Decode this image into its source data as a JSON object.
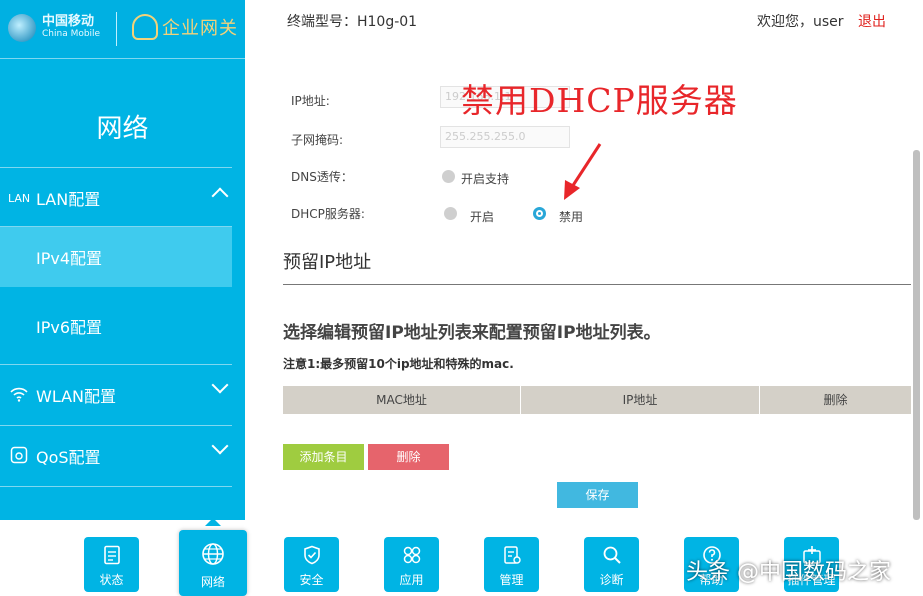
{
  "sidebar": {
    "logo_cn": "中国移动",
    "logo_en": "China Mobile",
    "brand": "企业网关",
    "section_title": "网络",
    "items": [
      {
        "icon": "LAN",
        "label": "LAN配置",
        "chevron": "up"
      },
      {
        "label": "IPv4配置",
        "active": true
      },
      {
        "label": "IPv6配置"
      },
      {
        "icon": "wifi-icon",
        "label": "WLAN配置",
        "chevron": "down"
      },
      {
        "icon": "qos-icon",
        "label": "QoS配置",
        "chevron": "down"
      }
    ]
  },
  "header": {
    "model_label": "终端型号：H10g-01",
    "welcome": "欢迎您，user",
    "logout": "退出"
  },
  "annotation": "禁用DHCP服务器",
  "form": {
    "ip_label": "IP地址:",
    "ip_value": "192.168.1.1",
    "mask_label": "子网掩码:",
    "mask_value": "255.255.255.0",
    "dns_label": "DNS透传：",
    "dns_option": "开启支持",
    "dhcp_label": "DHCP服务器:",
    "dhcp_on": "开启",
    "dhcp_off": "禁用",
    "dhcp_selected": "禁用"
  },
  "reserved": {
    "title": "预留IP地址",
    "instruction": "选择编辑预留IP地址列表来配置预留IP地址列表。",
    "note": "注意1:最多预留10个ip地址和特殊的mac.",
    "columns": [
      "MAC地址",
      "IP地址",
      "删除"
    ],
    "add_button": "添加条目",
    "delete_button": "删除",
    "save_button": "保存"
  },
  "dock": [
    {
      "icon": "status-icon",
      "label": "状态"
    },
    {
      "icon": "globe-icon",
      "label": "网络",
      "active": true
    },
    {
      "icon": "shield-icon",
      "label": "安全"
    },
    {
      "icon": "apps-icon",
      "label": "应用"
    },
    {
      "icon": "manage-icon",
      "label": "管理"
    },
    {
      "icon": "search-icon",
      "label": "诊断"
    },
    {
      "icon": "help-icon",
      "label": "帮助"
    },
    {
      "icon": "plugin-icon",
      "label": "插件管理"
    }
  ],
  "watermark": "头条 @中国数码之家",
  "colors": {
    "primary": "#00b4e4",
    "add": "#9fcc40",
    "delete": "#e6646c",
    "save": "#41b8e0",
    "annotation": "#e8262a"
  }
}
